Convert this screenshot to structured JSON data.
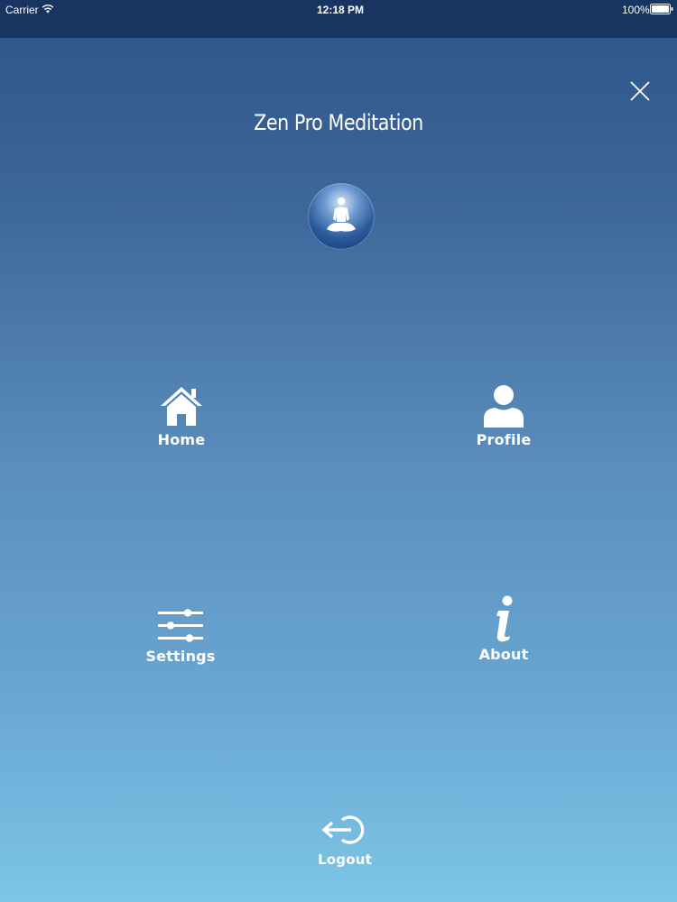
{
  "status_bar": {
    "carrier": "Carrier",
    "time": "12:18 PM",
    "battery": "100%"
  },
  "header": {
    "title": "Zen Pro Meditation"
  },
  "menu": {
    "home": {
      "label": "Home",
      "icon": "home-icon"
    },
    "profile": {
      "label": "Profile",
      "icon": "user-icon"
    },
    "settings": {
      "label": "Settings",
      "icon": "sliders-icon"
    },
    "about": {
      "label": "About",
      "icon": "info-icon"
    },
    "logout": {
      "label": "Logout",
      "icon": "logout-icon"
    }
  },
  "colors": {
    "status_bar": "#183561",
    "gradient_top": "#2f5489",
    "gradient_bottom": "#7cc6e6",
    "text": "#ffffff"
  }
}
